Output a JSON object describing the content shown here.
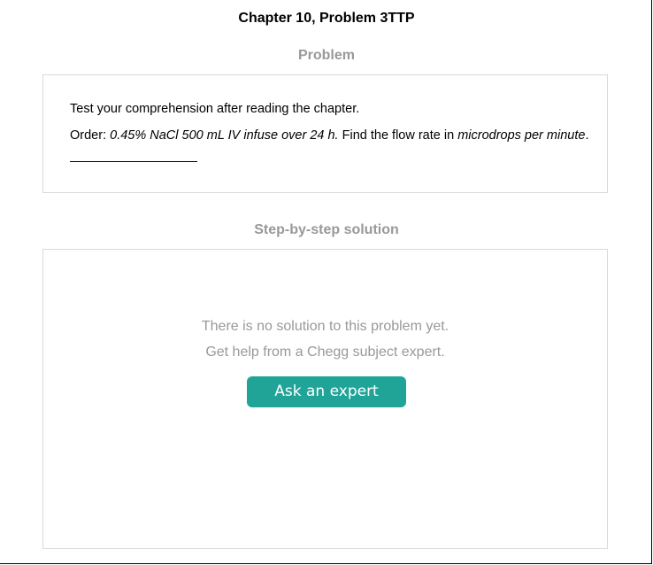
{
  "page": {
    "title": "Chapter 10, Problem 3TTP"
  },
  "problem": {
    "heading": "Problem",
    "intro": "Test your comprehension after reading the chapter.",
    "order_prefix": "Order: ",
    "order_italic": "0.45% NaCl 500 mL IV infuse over 24 h.",
    "order_middle": " Find the flow rate in ",
    "order_units": "microdrops per minute",
    "order_end": "."
  },
  "solution": {
    "heading": "Step-by-step solution",
    "no_solution_line1": "There is no solution to this problem yet.",
    "no_solution_line2": "Get help from a Chegg subject expert.",
    "ask_button_label": "Ask an expert"
  },
  "colors": {
    "accent": "#21a498",
    "muted_text": "#999999",
    "border": "#d9d9d9"
  }
}
